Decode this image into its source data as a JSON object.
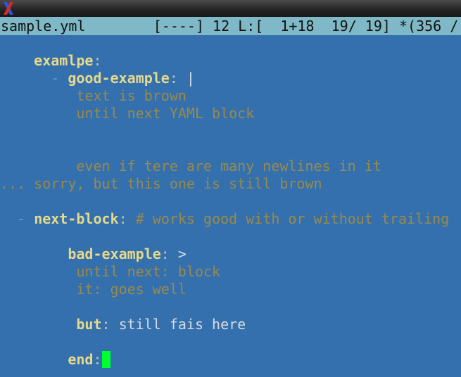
{
  "statusbar": {
    "filename": "sample.yml",
    "mode": "[----]",
    "col": "12",
    "position": "L:[  1+18  19/ 19]",
    "bytes": "*(356 /"
  },
  "lines": [
    {
      "indent": "    ",
      "key": "examlpe",
      "colon": ":"
    },
    {
      "indent": "      ",
      "dash": "-",
      "key": "good-example",
      "colon": ":",
      "value": " |"
    },
    {
      "text": "         text is brown"
    },
    {
      "text": "         until next YAML block"
    },
    {
      "text": "         even if tere are many newlines in it"
    },
    {
      "text": "... sorry, but this one is still brown"
    },
    {
      "indent": "  ",
      "dash": "-",
      "key": "next-block",
      "colon": ":",
      "comment": "# works good with or without trailing '"
    },
    {
      "indent": "        ",
      "key": "bad-example",
      "colon": ":",
      "value": " >"
    },
    {
      "text": "         until next: block"
    },
    {
      "text": "         it: goes well"
    },
    {
      "indent": "         ",
      "key": "but",
      "colon": ":",
      "value": " still fais here"
    },
    {
      "indent": "        ",
      "key": "end",
      "colon": ":"
    }
  ],
  "colors": {
    "background": "#3470ae",
    "statusbar": "#7fb8c6",
    "key": "#e6d98a",
    "brown_text": "#9a8a4a",
    "cursor": "#00ff2e"
  }
}
